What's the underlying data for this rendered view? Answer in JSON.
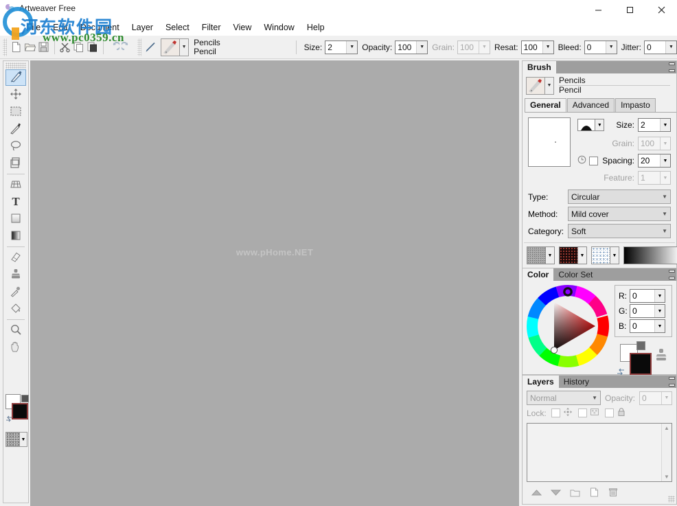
{
  "window": {
    "title": "Artweaver Free",
    "icon": "artweaver-app-icon",
    "minimize": "–",
    "maximize": "☐",
    "close": "✕"
  },
  "watermarks": {
    "site_cn": "河东软件园",
    "site_url": "www.pc0359.cn",
    "canvas_text": "www.pHome.NET"
  },
  "menubar": {
    "items": [
      {
        "label": "File"
      },
      {
        "label": "Edit"
      },
      {
        "label": "Document"
      },
      {
        "label": "Layer"
      },
      {
        "label": "Select"
      },
      {
        "label": "Filter"
      },
      {
        "label": "View"
      },
      {
        "label": "Window"
      },
      {
        "label": "Help"
      }
    ]
  },
  "toolbar": {
    "buttons": [
      {
        "name": "new-document",
        "glyph": "new-file-icon"
      },
      {
        "name": "open-document",
        "glyph": "open-folder-icon"
      },
      {
        "name": "save-document",
        "glyph": "save-disk-icon"
      },
      {
        "name": "cut",
        "glyph": "scissors-icon"
      },
      {
        "name": "copy",
        "glyph": "copy-icon"
      },
      {
        "name": "paste",
        "glyph": "paste-icon"
      },
      {
        "name": "undo",
        "glyph": "undo-arrow-icon"
      },
      {
        "name": "redo",
        "glyph": "redo-arrow-icon"
      },
      {
        "name": "brush-tool",
        "glyph": "pencil-icon"
      }
    ],
    "brush_preset": {
      "category": "Pencils",
      "variant": "Pencil"
    },
    "options": [
      {
        "label": "Size:",
        "value": "2",
        "disabled": false
      },
      {
        "label": "Opacity:",
        "value": "100",
        "disabled": false
      },
      {
        "label": "Grain:",
        "value": "100",
        "disabled": true
      },
      {
        "label": "Resat:",
        "value": "100",
        "disabled": false
      },
      {
        "label": "Bleed:",
        "value": "0",
        "disabled": false
      },
      {
        "label": "Jitter:",
        "value": "0",
        "disabled": false
      }
    ]
  },
  "tools": {
    "items": [
      {
        "name": "brush-tool",
        "icon": "paintbrush-icon",
        "selected": true
      },
      {
        "name": "move-tool",
        "icon": "move-arrows-icon",
        "selected": false
      },
      {
        "name": "rect-select-tool",
        "icon": "marquee-icon",
        "selected": false
      },
      {
        "name": "magic-wand-tool",
        "icon": "magic-wand-icon",
        "selected": false
      },
      {
        "name": "lasso-tool",
        "icon": "lasso-icon",
        "selected": false
      },
      {
        "name": "crop-tool",
        "icon": "crop-icon",
        "selected": false
      },
      {
        "name": "perspective-tool",
        "icon": "grid-transform-icon",
        "selected": false
      },
      {
        "name": "text-tool",
        "icon": "text-T-icon",
        "selected": false
      },
      {
        "name": "shape-tool",
        "icon": "square-shape-icon",
        "selected": false
      },
      {
        "name": "gradient-tool",
        "icon": "gradient-icon",
        "selected": false
      },
      {
        "name": "eraser-tool",
        "icon": "eraser-icon",
        "selected": false
      },
      {
        "name": "clone-stamp-tool",
        "icon": "stamp-icon",
        "selected": false
      },
      {
        "name": "eyedropper-tool",
        "icon": "eyedropper-icon",
        "selected": false
      },
      {
        "name": "paint-bucket-tool",
        "icon": "paint-bucket-icon",
        "selected": false
      },
      {
        "name": "zoom-tool",
        "icon": "magnifier-icon",
        "selected": false
      },
      {
        "name": "hand-tool",
        "icon": "hand-icon",
        "selected": false
      }
    ],
    "colors": {
      "foreground": "#ffffff",
      "background": "#0a0a0a"
    }
  },
  "brush_panel": {
    "title": "Brush",
    "preset": {
      "category": "Pencils",
      "variant": "Pencil"
    },
    "tabs": [
      {
        "label": "General",
        "active": true
      },
      {
        "label": "Advanced",
        "active": false
      },
      {
        "label": "Impasto",
        "active": false
      }
    ],
    "fields": [
      {
        "label": "Size:",
        "value": "2",
        "disabled": false
      },
      {
        "label": "Grain:",
        "value": "100",
        "disabled": true
      },
      {
        "label": "Spacing:",
        "value": "20",
        "disabled": false
      },
      {
        "label": "Feature:",
        "value": "1",
        "disabled": true
      }
    ],
    "combos": [
      {
        "label": "Type:",
        "value": "Circular",
        "disabled": false
      },
      {
        "label": "Method:",
        "value": "Mild cover",
        "disabled": false
      },
      {
        "label": "Category:",
        "value": "Soft",
        "disabled": false
      }
    ],
    "swatches": [
      {
        "name": "paper-texture-swatch"
      },
      {
        "name": "grain-pattern-swatch"
      },
      {
        "name": "dab-pattern-swatch"
      },
      {
        "name": "gradient-swatch"
      }
    ]
  },
  "color_panel": {
    "tabs": [
      {
        "label": "Color",
        "active": true
      },
      {
        "label": "Color Set",
        "active": false
      }
    ],
    "channels": [
      {
        "label": "R:",
        "value": "0"
      },
      {
        "label": "G:",
        "value": "0"
      },
      {
        "label": "B:",
        "value": "0"
      }
    ],
    "foreground": "#ffffff",
    "background": "#0a0a0a"
  },
  "layers_panel": {
    "tabs": [
      {
        "label": "Layers",
        "active": true
      },
      {
        "label": "History",
        "active": false
      }
    ],
    "blend_mode": "Normal",
    "opacity_label": "Opacity:",
    "opacity_value": "0",
    "lock_label": "Lock:",
    "lock_items": [
      {
        "name": "lock-transparency-checkbox",
        "icon": "move-lock-icon"
      },
      {
        "name": "lock-pixels-checkbox",
        "icon": "pixels-lock-icon"
      },
      {
        "name": "lock-all-checkbox",
        "icon": "padlock-icon"
      }
    ],
    "buttons": [
      {
        "name": "raise-layer-button",
        "icon": "up-triangle-icon"
      },
      {
        "name": "lower-layer-button",
        "icon": "down-triangle-icon"
      },
      {
        "name": "new-group-button",
        "icon": "folder-icon"
      },
      {
        "name": "new-layer-button",
        "icon": "page-icon"
      },
      {
        "name": "delete-layer-button",
        "icon": "trash-icon"
      }
    ]
  }
}
